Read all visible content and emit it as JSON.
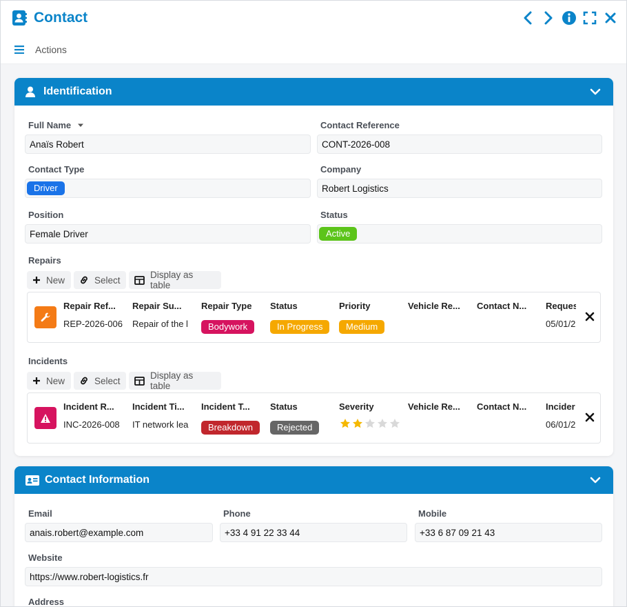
{
  "window": {
    "title": "Contact"
  },
  "actionbar": {
    "actions_label": "Actions"
  },
  "identification": {
    "title": "Identification",
    "full_name": {
      "label": "Full Name",
      "value": "Anaïs Robert"
    },
    "contact_reference": {
      "label": "Contact Reference",
      "value": "CONT-2026-008"
    },
    "contact_type": {
      "label": "Contact Type",
      "value": "Driver"
    },
    "company": {
      "label": "Company",
      "value": "Robert Logistics"
    },
    "position": {
      "label": "Position",
      "value": "Female Driver"
    },
    "status": {
      "label": "Status",
      "value": "Active"
    }
  },
  "repairs": {
    "label": "Repairs",
    "buttons": {
      "new": "New",
      "select": "Select",
      "display_table": "Display as table"
    },
    "columns": [
      "Repair Ref...",
      "Repair Su...",
      "Repair Type",
      "Status",
      "Priority",
      "Vehicle Re...",
      "Contact N...",
      "Reques"
    ],
    "row": {
      "reference": "REP-2026-006",
      "subject": "Repair of the le",
      "type": "Bodywork",
      "status": "In Progress",
      "priority": "Medium",
      "requested": "05/01/2"
    }
  },
  "incidents": {
    "label": "Incidents",
    "buttons": {
      "new": "New",
      "select": "Select",
      "display_table": "Display as table"
    },
    "columns": [
      "Incident R...",
      "Incident Ti...",
      "Incident T...",
      "Status",
      "Severity",
      "Vehicle Re...",
      "Contact N...",
      "Incider"
    ],
    "row": {
      "reference": "INC-2026-008",
      "title": "IT network lea",
      "type": "Breakdown",
      "status": "Rejected",
      "severity_rating": 2,
      "severity_max": 5,
      "date": "06/01/2"
    }
  },
  "contact_info": {
    "title": "Contact Information",
    "email": {
      "label": "Email",
      "value": "anais.robert@example.com"
    },
    "phone": {
      "label": "Phone",
      "value": "+33 4 91 22 33 44"
    },
    "mobile": {
      "label": "Mobile",
      "value": "+33 6 87 09 21 43"
    },
    "website": {
      "label": "Website",
      "value": "https://www.robert-logistics.fr"
    },
    "address": {
      "label": "Address"
    }
  },
  "colors": {
    "accent": "#0a84c9",
    "driver_chip": "#1a73e8",
    "active_chip": "#5cc41a",
    "bodywork_chip": "#d6135f",
    "in_progress_chip": "#f5a800",
    "medium_chip": "#f5a800",
    "breakdown_chip": "#c1272d",
    "rejected_chip": "#666666",
    "repair_icon_bg": "#f47b16",
    "incident_icon_bg": "#d6135f",
    "star_on": "#f5b800",
    "star_off": "#d9d9d9"
  }
}
